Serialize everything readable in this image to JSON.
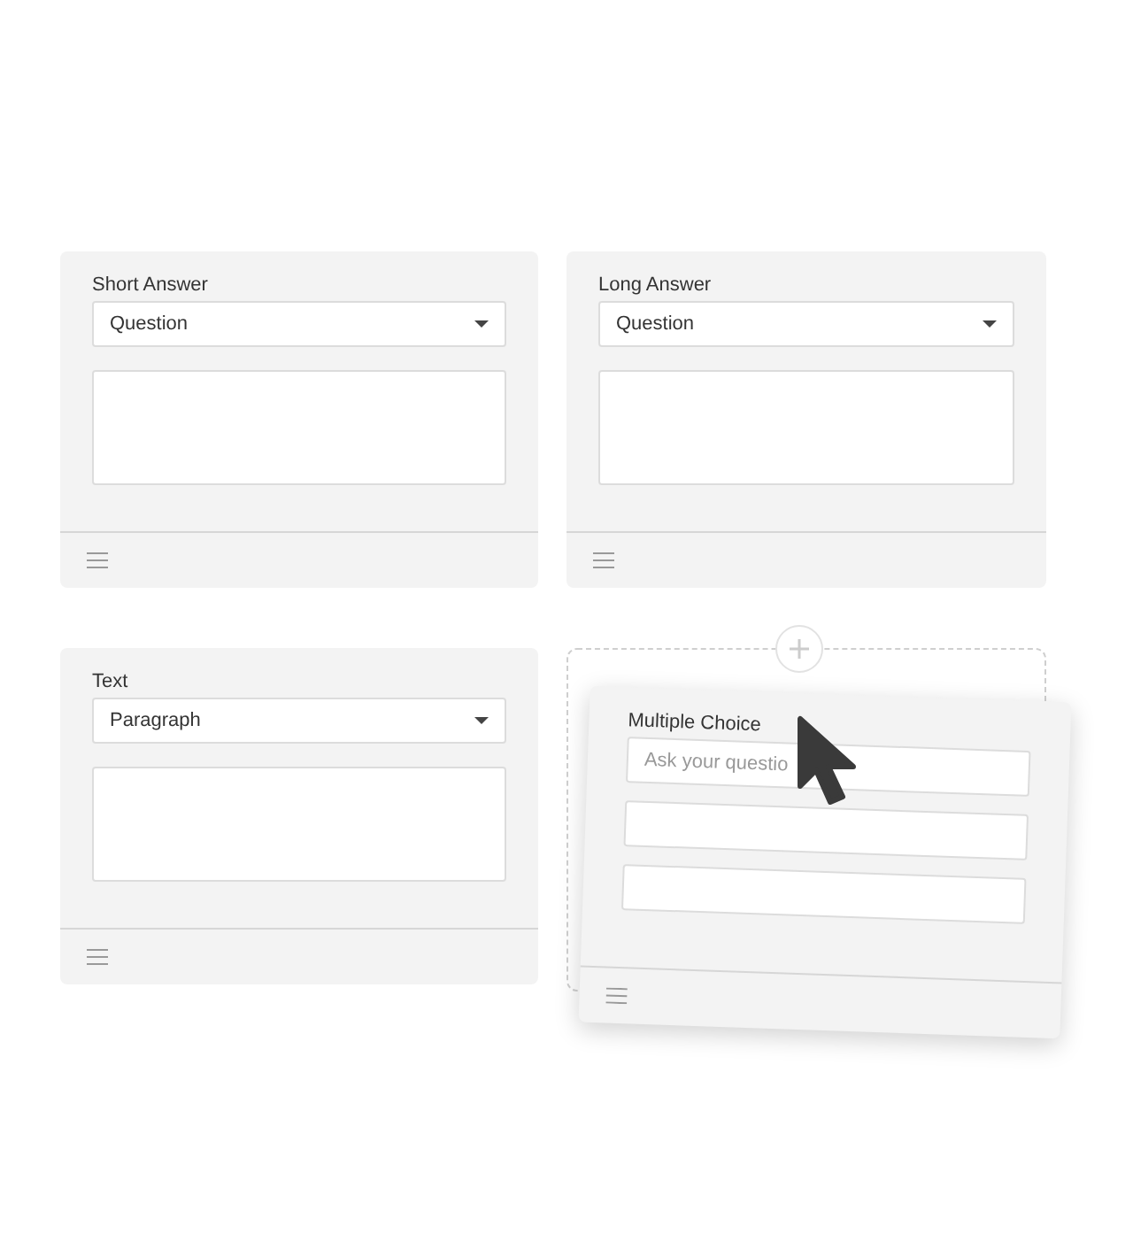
{
  "cards": [
    {
      "kind": "select",
      "title": "Short Answer",
      "value": "Question"
    },
    {
      "kind": "select",
      "title": "Long Answer",
      "value": "Question"
    },
    {
      "kind": "select",
      "title": "Text",
      "value": "Paragraph"
    }
  ],
  "dragged_card": {
    "title": "Multiple Choice",
    "placeholder": "Ask your questio",
    "option_fields": [
      {
        "kind": "blank"
      },
      {
        "kind": "blank"
      }
    ]
  }
}
